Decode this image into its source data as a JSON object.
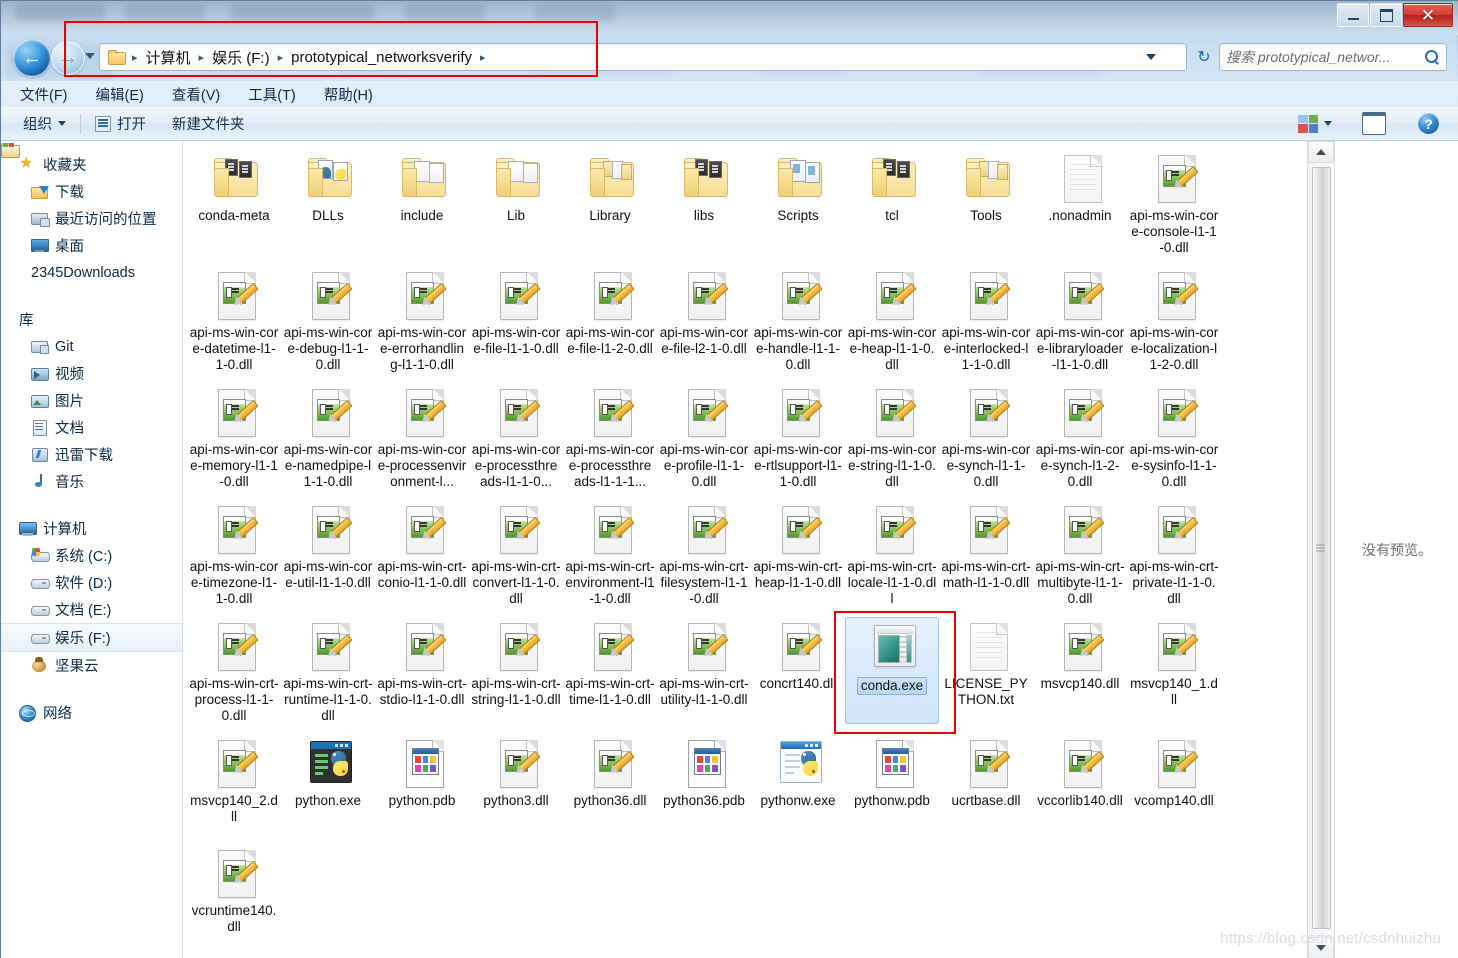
{
  "window": {
    "caption_buttons": [
      {
        "name": "minimize",
        "glyph": "–"
      },
      {
        "name": "maximize",
        "glyph": "□"
      },
      {
        "name": "close",
        "glyph": "✕"
      }
    ]
  },
  "address_bar": {
    "back_glyph": "←",
    "forward_glyph": "→",
    "refresh_glyph": "↻",
    "separator": "▸",
    "crumbs": [
      "计算机",
      "娱乐 (F:)",
      "prototypical_networksverify"
    ]
  },
  "search": {
    "placeholder": "搜索 prototypical_networ..."
  },
  "menubar": {
    "items": [
      "文件(F)",
      "编辑(E)",
      "查看(V)",
      "工具(T)",
      "帮助(H)"
    ]
  },
  "toolbar": {
    "organize": "组织",
    "open": "打开",
    "new_folder": "新建文件夹",
    "help_glyph": "?"
  },
  "navpane": {
    "groups": [
      {
        "header": {
          "label": "收藏夹",
          "icon": "favorites-star-icon"
        },
        "items": [
          {
            "label": "下载",
            "icon": "downloads-icon"
          },
          {
            "label": "最近访问的位置",
            "icon": "recent-places-icon"
          },
          {
            "label": "桌面",
            "icon": "desktop-icon"
          },
          {
            "label": "2345Downloads",
            "icon": "folder-icon"
          }
        ]
      },
      {
        "header": {
          "label": "库",
          "icon": "library-icon"
        },
        "items": [
          {
            "label": "Git",
            "icon": "git-library-icon"
          },
          {
            "label": "视频",
            "icon": "videos-icon"
          },
          {
            "label": "图片",
            "icon": "pictures-icon"
          },
          {
            "label": "文档",
            "icon": "documents-icon"
          },
          {
            "label": "迅雷下载",
            "icon": "thunder-download-icon"
          },
          {
            "label": "音乐",
            "icon": "music-icon"
          }
        ]
      },
      {
        "header": {
          "label": "计算机",
          "icon": "computer-icon"
        },
        "items": [
          {
            "label": "系统 (C:)",
            "icon": "system-drive-icon"
          },
          {
            "label": "软件 (D:)",
            "icon": "drive-icon"
          },
          {
            "label": "文档 (E:)",
            "icon": "drive-icon"
          },
          {
            "label": "娱乐 (F:)",
            "icon": "drive-icon",
            "selected": true
          },
          {
            "label": "坚果云",
            "icon": "nutstore-icon"
          }
        ]
      },
      {
        "header": {
          "label": "网络",
          "icon": "network-icon"
        },
        "items": []
      }
    ]
  },
  "preview_pane": {
    "message": "没有预览。"
  },
  "watermark": {
    "text": "https://blog.csdn.net/csdnhuizhu"
  },
  "annotations": {
    "address_bar_highlight_color": "#e60000",
    "conda_highlight_color": "#e60000",
    "selection_color": "#cde3f7"
  },
  "files": [
    {
      "name": "conda-meta",
      "icon": "folder-dark"
    },
    {
      "name": "DLLs",
      "icon": "folder-python"
    },
    {
      "name": "include",
      "icon": "folder-doc"
    },
    {
      "name": "Lib",
      "icon": "folder-doc"
    },
    {
      "name": "Library",
      "icon": "folder-sub"
    },
    {
      "name": "libs",
      "icon": "folder-dark"
    },
    {
      "name": "Scripts",
      "icon": "folder-script"
    },
    {
      "name": "tcl",
      "icon": "folder-dark"
    },
    {
      "name": "Tools",
      "icon": "folder-sub"
    },
    {
      "name": ".nonadmin",
      "icon": "blank-doc"
    },
    {
      "name": "api-ms-win-core-console-l1-1-0.dll",
      "icon": "dll-doc"
    },
    {
      "name": "api-ms-win-core-datetime-l1-1-0.dll",
      "icon": "dll-doc"
    },
    {
      "name": "api-ms-win-core-debug-l1-1-0.dll",
      "icon": "dll-doc"
    },
    {
      "name": "api-ms-win-core-errorhandling-l1-1-0.dll",
      "icon": "dll-doc"
    },
    {
      "name": "api-ms-win-core-file-l1-1-0.dll",
      "icon": "dll-doc"
    },
    {
      "name": "api-ms-win-core-file-l1-2-0.dll",
      "icon": "dll-doc"
    },
    {
      "name": "api-ms-win-core-file-l2-1-0.dll",
      "icon": "dll-doc"
    },
    {
      "name": "api-ms-win-core-handle-l1-1-0.dll",
      "icon": "dll-doc"
    },
    {
      "name": "api-ms-win-core-heap-l1-1-0.dll",
      "icon": "dll-doc"
    },
    {
      "name": "api-ms-win-core-interlocked-l1-1-0.dll",
      "icon": "dll-doc"
    },
    {
      "name": "api-ms-win-core-libraryloader-l1-1-0.dll",
      "icon": "dll-doc"
    },
    {
      "name": "api-ms-win-core-localization-l1-2-0.dll",
      "icon": "dll-doc"
    },
    {
      "name": "api-ms-win-core-memory-l1-1-0.dll",
      "icon": "dll-doc"
    },
    {
      "name": "api-ms-win-core-namedpipe-l1-1-0.dll",
      "icon": "dll-doc"
    },
    {
      "name": "api-ms-win-core-processenvironment-l...",
      "icon": "dll-doc"
    },
    {
      "name": "api-ms-win-core-processthreads-l1-1-0...",
      "icon": "dll-doc"
    },
    {
      "name": "api-ms-win-core-processthreads-l1-1-1...",
      "icon": "dll-doc"
    },
    {
      "name": "api-ms-win-core-profile-l1-1-0.dll",
      "icon": "dll-doc"
    },
    {
      "name": "api-ms-win-core-rtlsupport-l1-1-0.dll",
      "icon": "dll-doc"
    },
    {
      "name": "api-ms-win-core-string-l1-1-0.dll",
      "icon": "dll-doc"
    },
    {
      "name": "api-ms-win-core-synch-l1-1-0.dll",
      "icon": "dll-doc"
    },
    {
      "name": "api-ms-win-core-synch-l1-2-0.dll",
      "icon": "dll-doc"
    },
    {
      "name": "api-ms-win-core-sysinfo-l1-1-0.dll",
      "icon": "dll-doc"
    },
    {
      "name": "api-ms-win-core-timezone-l1-1-0.dll",
      "icon": "dll-doc"
    },
    {
      "name": "api-ms-win-core-util-l1-1-0.dll",
      "icon": "dll-doc"
    },
    {
      "name": "api-ms-win-crt-conio-l1-1-0.dll",
      "icon": "dll-doc"
    },
    {
      "name": "api-ms-win-crt-convert-l1-1-0.dll",
      "icon": "dll-doc"
    },
    {
      "name": "api-ms-win-crt-environment-l1-1-0.dll",
      "icon": "dll-doc"
    },
    {
      "name": "api-ms-win-crt-filesystem-l1-1-0.dll",
      "icon": "dll-doc"
    },
    {
      "name": "api-ms-win-crt-heap-l1-1-0.dll",
      "icon": "dll-doc"
    },
    {
      "name": "api-ms-win-crt-locale-l1-1-0.dll",
      "icon": "dll-doc"
    },
    {
      "name": "api-ms-win-crt-math-l1-1-0.dll",
      "icon": "dll-doc"
    },
    {
      "name": "api-ms-win-crt-multibyte-l1-1-0.dll",
      "icon": "dll-doc"
    },
    {
      "name": "api-ms-win-crt-private-l1-1-0.dll",
      "icon": "dll-doc"
    },
    {
      "name": "api-ms-win-crt-process-l1-1-0.dll",
      "icon": "dll-doc"
    },
    {
      "name": "api-ms-win-crt-runtime-l1-1-0.dll",
      "icon": "dll-doc"
    },
    {
      "name": "api-ms-win-crt-stdio-l1-1-0.dll",
      "icon": "dll-doc"
    },
    {
      "name": "api-ms-win-crt-string-l1-1-0.dll",
      "icon": "dll-doc"
    },
    {
      "name": "api-ms-win-crt-time-l1-1-0.dll",
      "icon": "dll-doc"
    },
    {
      "name": "api-ms-win-crt-utility-l1-1-0.dll",
      "icon": "dll-doc"
    },
    {
      "name": "concrt140.dll",
      "icon": "dll-doc"
    },
    {
      "name": "conda.exe",
      "icon": "app-exe",
      "selected": true
    },
    {
      "name": "LICENSE_PYTHON.txt",
      "icon": "blank-doc"
    },
    {
      "name": "msvcp140.dll",
      "icon": "dll-doc"
    },
    {
      "name": "msvcp140_1.dll",
      "icon": "dll-doc"
    },
    {
      "name": "msvcp140_2.dll",
      "icon": "dll-doc"
    },
    {
      "name": "python.exe",
      "icon": "python-console"
    },
    {
      "name": "python.pdb",
      "icon": "pdb-doc"
    },
    {
      "name": "python3.dll",
      "icon": "dll-doc"
    },
    {
      "name": "python36.dll",
      "icon": "dll-doc"
    },
    {
      "name": "python36.pdb",
      "icon": "pdb-doc"
    },
    {
      "name": "pythonw.exe",
      "icon": "pythonw-app"
    },
    {
      "name": "pythonw.pdb",
      "icon": "pdb-doc"
    },
    {
      "name": "ucrtbase.dll",
      "icon": "dll-doc"
    },
    {
      "name": "vccorlib140.dll",
      "icon": "dll-doc"
    },
    {
      "name": "vcomp140.dll",
      "icon": "dll-doc"
    },
    {
      "name": "vcruntime140.dll",
      "icon": "dll-doc"
    }
  ]
}
